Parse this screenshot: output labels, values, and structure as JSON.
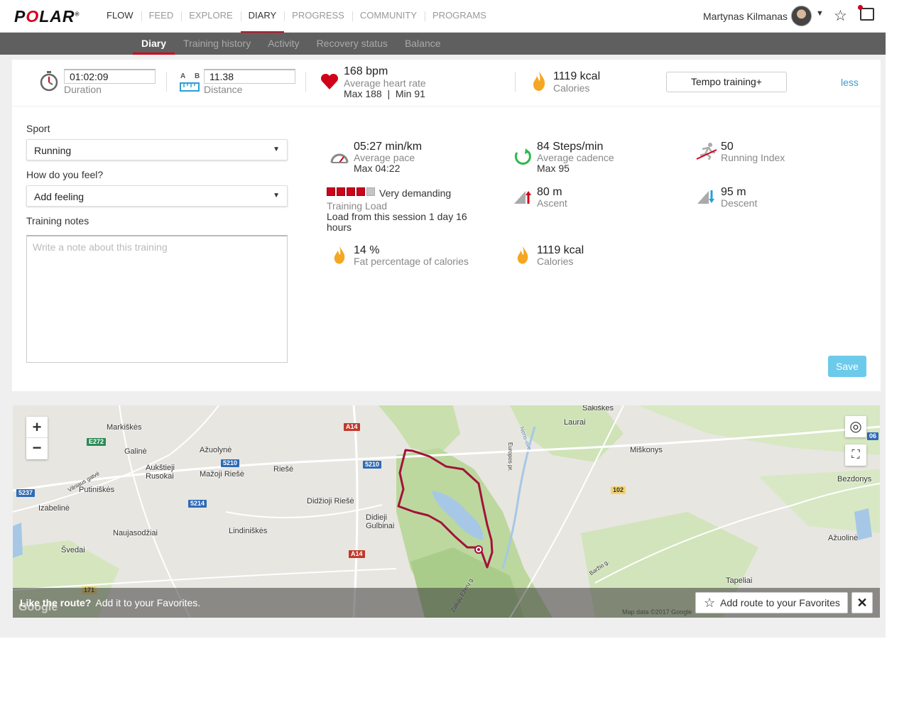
{
  "nav": {
    "logo": "POLAR",
    "items": [
      "FLOW",
      "FEED",
      "EXPLORE",
      "DIARY",
      "PROGRESS",
      "COMMUNITY",
      "PROGRAMS"
    ],
    "active": "DIARY",
    "user_name": "Martynas Kilmanas"
  },
  "subnav": {
    "items": [
      "Diary",
      "Training history",
      "Activity",
      "Recovery status",
      "Balance"
    ],
    "active": "Diary"
  },
  "summary": {
    "duration_value": "01:02:09",
    "duration_label": "Duration",
    "ab_a": "A",
    "ab_b": "B",
    "distance_value": "11.38",
    "distance_label": "Distance",
    "hr_value": "168 bpm",
    "hr_label": "Average heart rate",
    "hr_minmax": "Max 188  |  Min 91",
    "calories_value": "1119 kcal",
    "calories_label": "Calories",
    "sport_button": "Tempo training+",
    "less_link": "less"
  },
  "form": {
    "sport_label": "Sport",
    "sport_value": "Running",
    "feel_label": "How do you feel?",
    "feel_value": "Add feeling",
    "notes_label": "Training notes",
    "notes_placeholder": "Write a note about this training",
    "save_label": "Save"
  },
  "stats": {
    "pace_value": "05:27 min/km",
    "pace_label": "Average pace",
    "pace_max": "Max 04:22",
    "cadence_value": "84 Steps/min",
    "cadence_label": "Average cadence",
    "cadence_max": "Max 95",
    "running_index_value": "50",
    "running_index_label": "Running Index",
    "load_level": "Very demanding",
    "load_label": "Training Load",
    "load_desc": "Load from this session 1 day 16 hours",
    "load_blocks_filled": 4,
    "load_blocks_total": 5,
    "ascent_value": "80 m",
    "ascent_label": "Ascent",
    "descent_value": "95 m",
    "descent_label": "Descent",
    "fat_value": "14 %",
    "fat_label": "Fat percentage of calories",
    "calories_value": "1119 kcal",
    "calories_label": "Calories"
  },
  "map": {
    "places": [
      "Sakiškės",
      "Laurai",
      "Markiškės",
      "Galinė",
      "Ažuolynė",
      "Aukštieji Rusokai",
      "Mažoji Riešė",
      "Riešė",
      "Miškonys",
      "Bezdonys",
      "Putiniškės",
      "Izabelinė",
      "Didžioji Riešė",
      "Didieji Gulbinai",
      "Naujasodžiai",
      "Lindiniškės",
      "Švedai",
      "Ažuolinė",
      "Tapeliai",
      "Vilniaus gatvė",
      "Europos pr.",
      "Neris-ove",
      "Baržio g.",
      "Zaliujų Ežerų g."
    ],
    "roads": [
      "E272",
      "A14",
      "5210",
      "5210",
      "5237",
      "5214",
      "102",
      "171",
      "A14",
      "06"
    ],
    "fav_bold": "Like the route?",
    "fav_text": "Add it to your Favorites.",
    "fav_button": "Add route to your Favorites",
    "map_data": "Map data ©2017 Google",
    "google": "Google"
  },
  "colors": {
    "brand_red": "#d0021b",
    "nav_active": "#b5152b",
    "subnav_bg": "#5f5f5f",
    "link_blue": "#3a9ad9",
    "save_blue": "#6ccaea",
    "route": "#a3123a"
  },
  "icons": [
    "stopwatch-icon",
    "ruler-icon",
    "heart-icon",
    "flame-icon",
    "gauge-icon",
    "cadence-icon",
    "runner-icon",
    "ascent-icon",
    "descent-icon",
    "star-icon",
    "message-icon",
    "plus-icon",
    "minus-icon",
    "locate-icon",
    "fullscreen-icon",
    "close-icon"
  ]
}
